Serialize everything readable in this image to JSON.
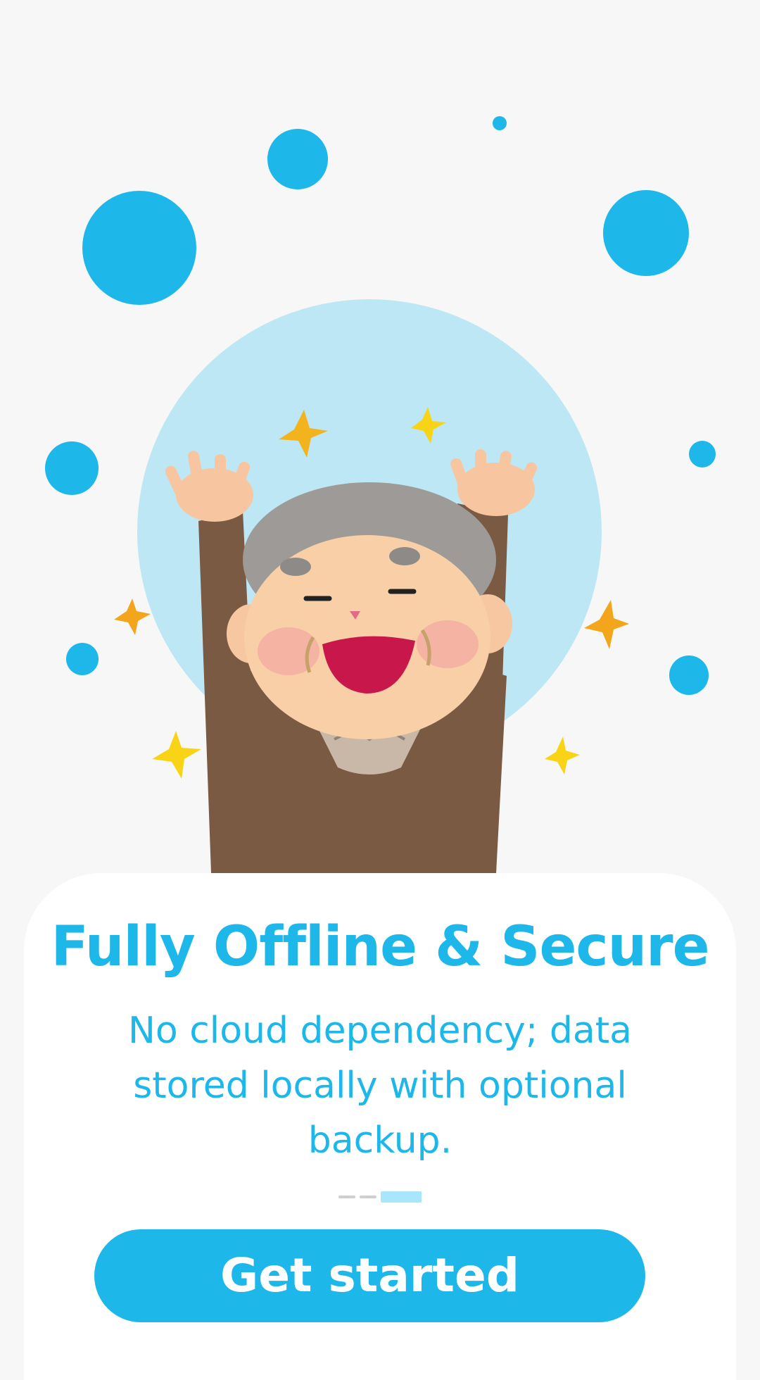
{
  "onboarding": {
    "title": "Fully Offline & Secure",
    "description": "No cloud dependency; data stored locally with optional backup.",
    "pagination": {
      "total_pages": 3,
      "current_page": 3
    },
    "cta_label": "Get started"
  },
  "illustration": {
    "subject": "happy-elderly-person-illustration",
    "decorations": [
      "blue-bubble-icon",
      "sparkle-star-icon"
    ]
  },
  "colors": {
    "background": "#f7f7f7",
    "accent": "#1db7ea",
    "light_accent": "#bde7f5",
    "card": "#ffffff",
    "inactive_dot": "#cfcfcf",
    "active_dot": "#a8e6fb"
  }
}
